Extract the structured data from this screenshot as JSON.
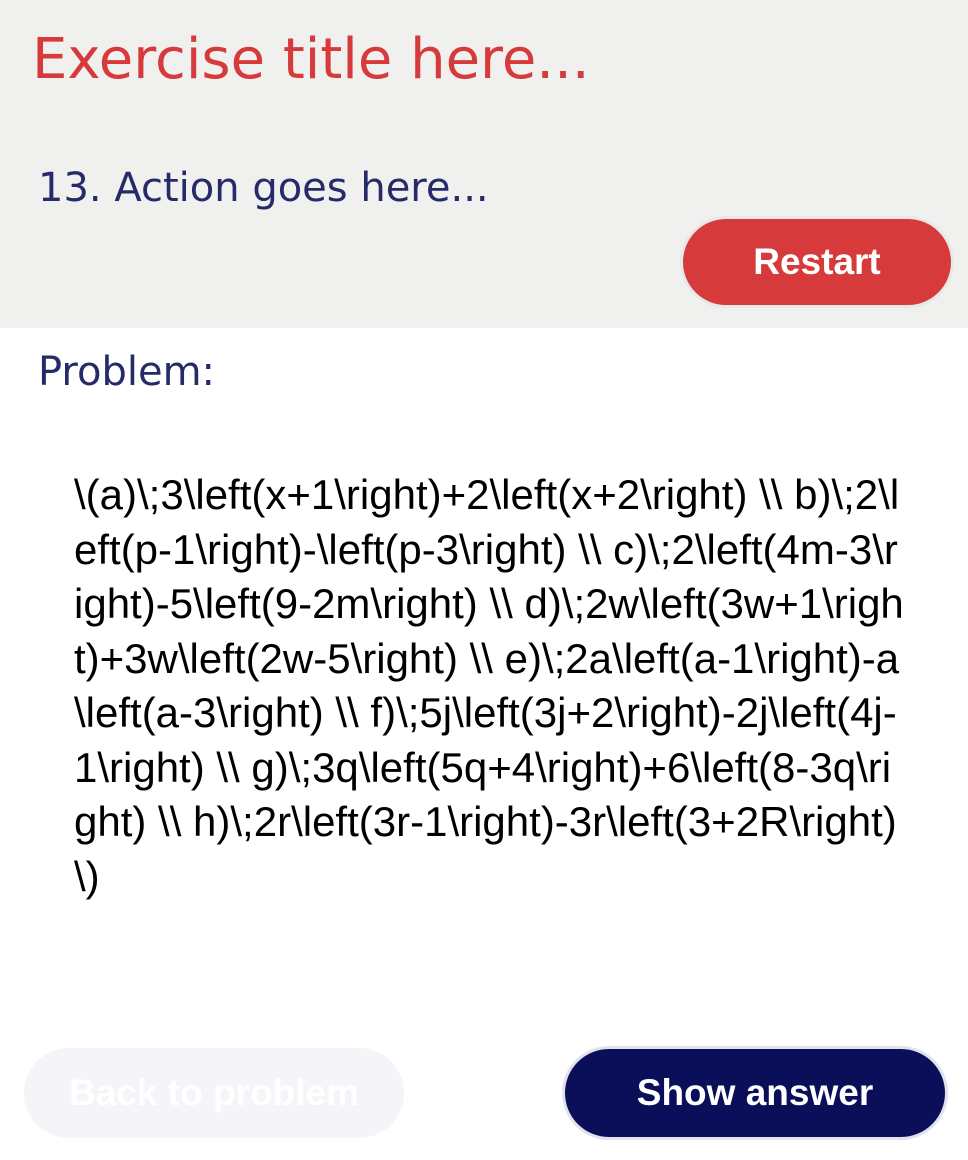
{
  "header": {
    "exercise_title": "Exercise title here...",
    "action": "13. Action goes here...",
    "restart_label": "Restart"
  },
  "problem": {
    "label": "Problem:",
    "body": "\\(a)\\;3\\left(x+1\\right)+2\\left(x+2\\right) \\\\ b)\\;2\\left(p-1\\right)-\\left(p-3\\right) \\\\ c)\\;2\\left(4m-3\\right)-5\\left(9-2m\\right) \\\\ d)\\;2w\\left(3w+1\\right)+3w\\left(2w-5\\right) \\\\ e)\\;2a\\left(a-1\\right)-a\\left(a-3\\right) \\\\ f)\\;5j\\left(3j+2\\right)-2j\\left(4j-1\\right) \\\\ g)\\;3q\\left(5q+4\\right)+6\\left(8-3q\\right) \\\\ h)\\;2r\\left(3r-1\\right)-3r\\left(3+2R\\right)\\)"
  },
  "footer": {
    "back_label": "Back to problem",
    "show_answer_label": "Show answer"
  },
  "colors": {
    "accent_red": "#d63a3a",
    "navy": "#0b0e58",
    "text_navy": "#252a68",
    "header_bg": "#f0f0ef"
  }
}
